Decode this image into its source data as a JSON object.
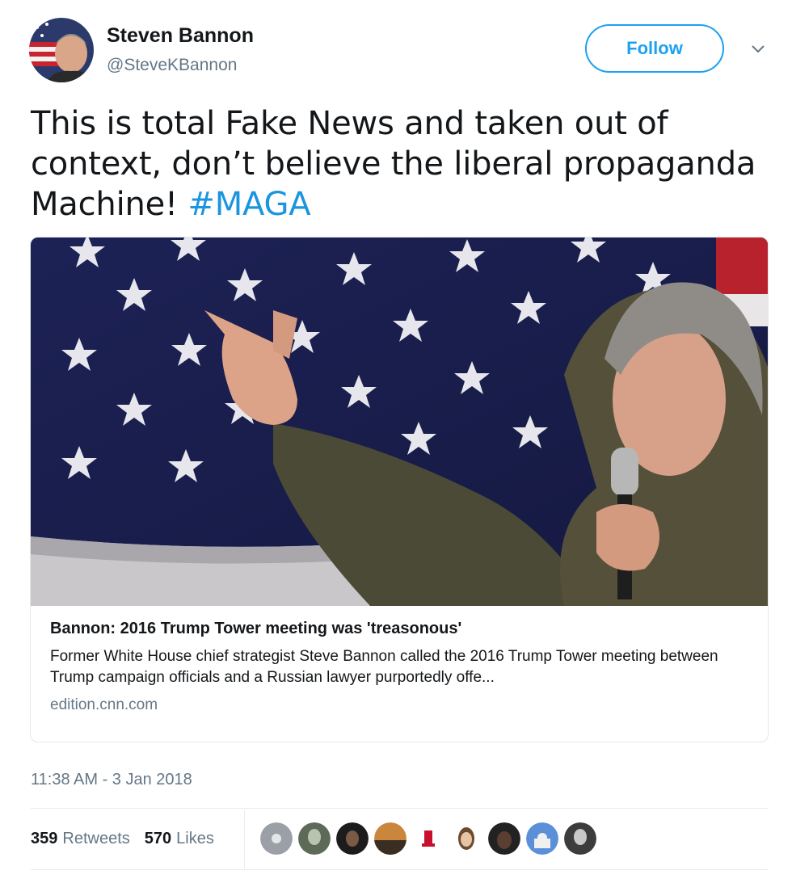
{
  "user": {
    "name": "Steven Bannon",
    "handle": "@SteveKBannon",
    "follow_label": "Follow"
  },
  "tweet": {
    "text": "This is total Fake News and taken out of context, don’t believe the liberal propaganda Machine! ",
    "hashtag": "#MAGA",
    "timestamp": "11:38 AM - 3 Jan 2018"
  },
  "card": {
    "title": "Bannon: 2016 Trump Tower meeting was 'treasonous'",
    "description": "Former White House chief strategist Steve Bannon called the 2016 Trump Tower meeting between Trump campaign officials and a Russian lawyer purportedly offe...",
    "domain": "edition.cnn.com"
  },
  "stats": {
    "retweets_count": "359",
    "retweets_label": "Retweets",
    "likes_count": "570",
    "likes_label": "Likes"
  },
  "colors": {
    "accent": "#1da1f2",
    "hashtag": "#1b95e0",
    "secondary_text": "#657786"
  }
}
